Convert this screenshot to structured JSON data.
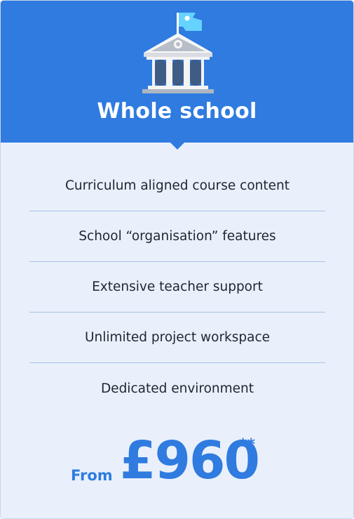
{
  "card": {
    "title": "Whole school",
    "icon": "school-building-icon",
    "features": [
      "Curriculum aligned course content",
      "School “organisation” features",
      "Extensive teacher support",
      "Unlimited project workspace",
      "Dedicated environment"
    ],
    "price": {
      "prefix": "From",
      "amount": "£960",
      "note_marker": "**"
    }
  },
  "colors": {
    "accent": "#2f7be0",
    "body_background": "#e9f0fb",
    "divider": "#a8c1e8",
    "text": "#1f2630",
    "flag": "#66d3ff"
  }
}
